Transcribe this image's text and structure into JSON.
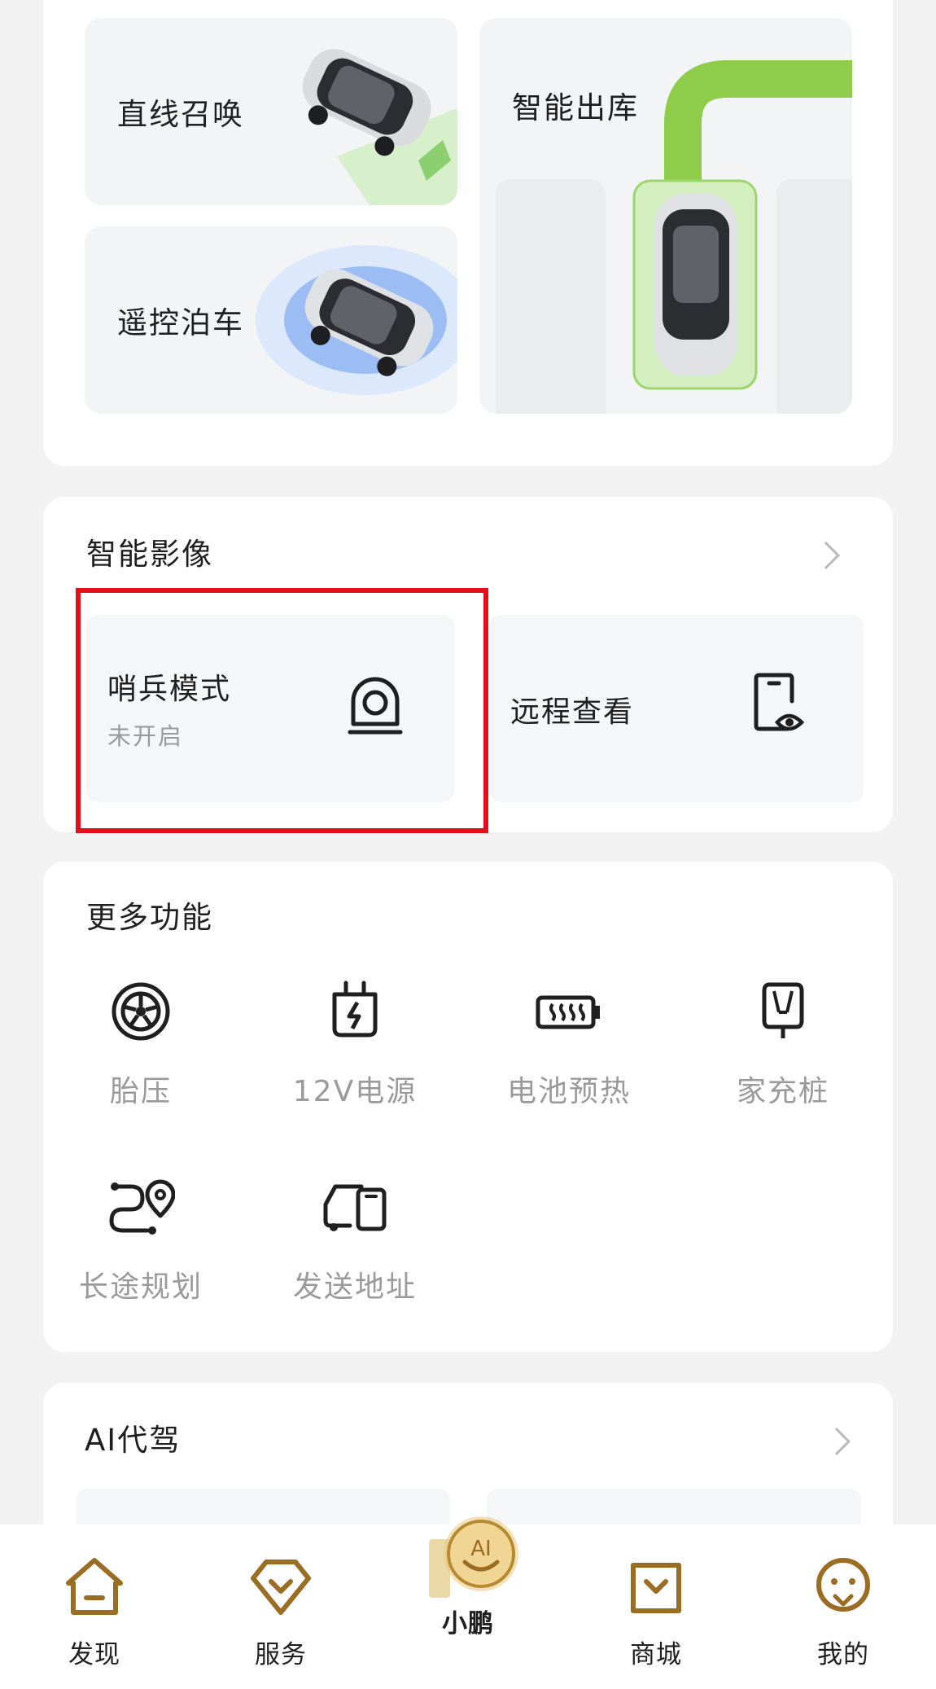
{
  "parking": {
    "straight_summon": "直线召唤",
    "remote_parking": "遥控泊车",
    "smart_exit": "智能出库"
  },
  "video": {
    "title": "智能影像",
    "sentry_title": "哨兵模式",
    "sentry_status": "未开启",
    "remote_view": "远程查看"
  },
  "more": {
    "title": "更多功能",
    "items": [
      {
        "label": "胎压",
        "icon": "tire-icon"
      },
      {
        "label": "12V电源",
        "icon": "power-plug-icon"
      },
      {
        "label": "电池预热",
        "icon": "battery-heat-icon"
      },
      {
        "label": "家充桩",
        "icon": "home-charger-icon"
      },
      {
        "label": "长途规划",
        "icon": "route-icon"
      },
      {
        "label": "发送地址",
        "icon": "send-address-icon"
      }
    ]
  },
  "ai_driver": {
    "title": "AI代驾"
  },
  "nav": {
    "items": [
      {
        "label": "发现",
        "icon": "home-icon"
      },
      {
        "label": "服务",
        "icon": "service-icon"
      },
      {
        "label": "小鹏",
        "icon": "xpeng-ai-icon"
      },
      {
        "label": "商城",
        "icon": "shop-icon"
      },
      {
        "label": "我的",
        "icon": "profile-icon"
      }
    ],
    "ai_badge": "AI"
  },
  "colors": {
    "highlight": "#e3101c",
    "nav_gold": "#9a6d22",
    "green_path": "#8fcc4a",
    "blue_glow": "#8fb6f5"
  }
}
